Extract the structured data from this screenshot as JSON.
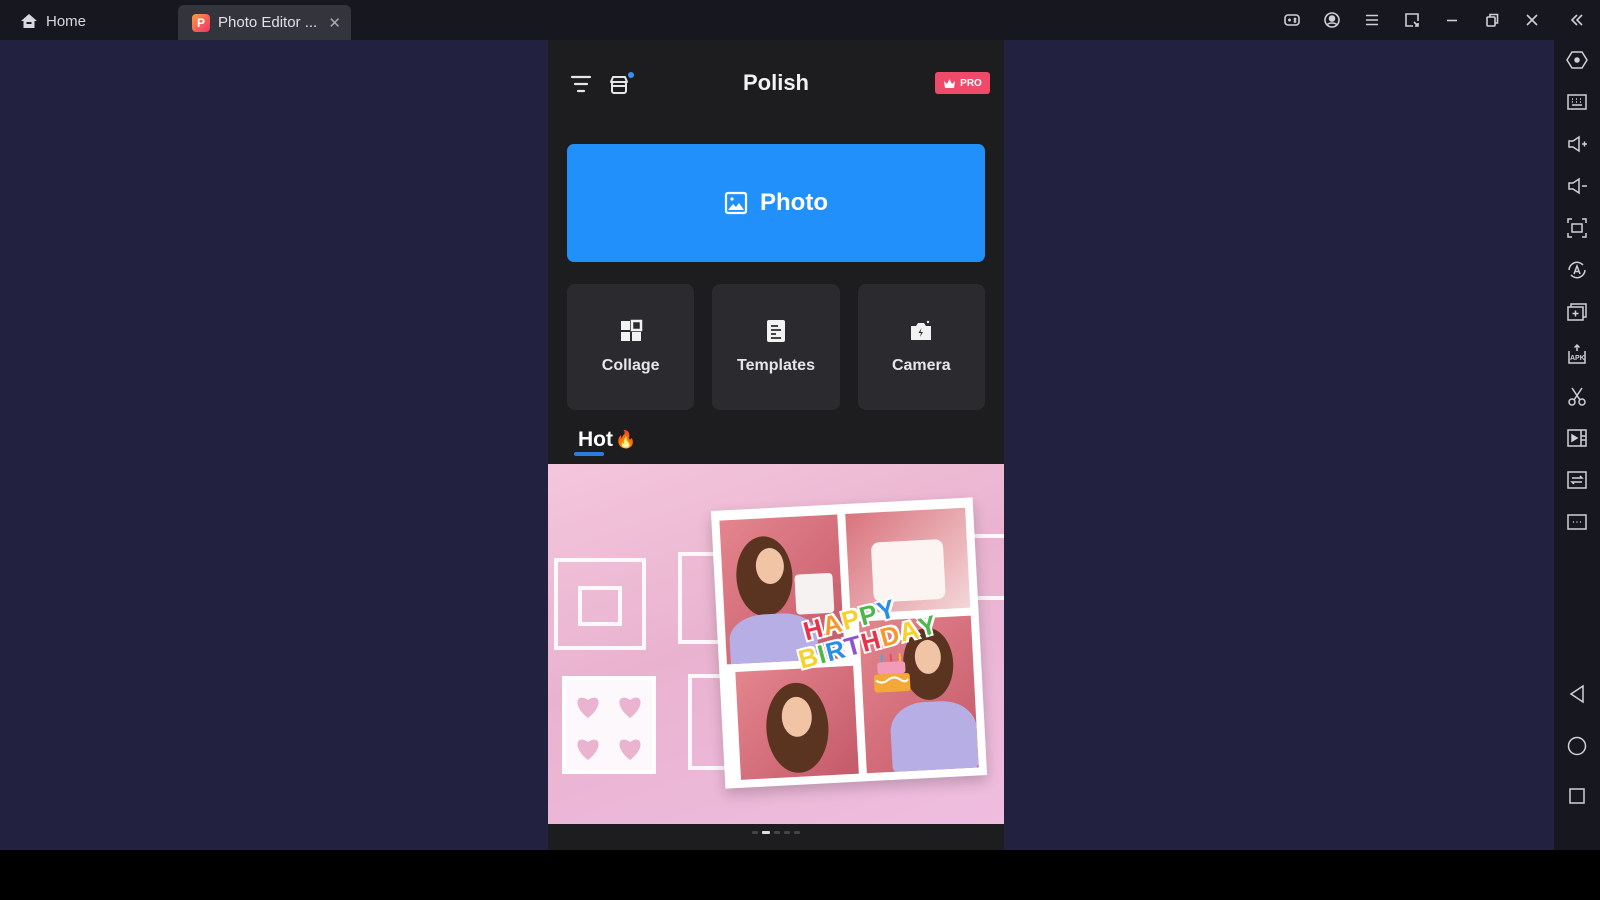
{
  "titlebar": {
    "home_tab": {
      "label": "Home",
      "icon": "home-icon"
    },
    "active_tab": {
      "label": "Photo Editor ...",
      "icon": "polish-app-icon",
      "close_icon": "close-icon"
    },
    "controls": [
      {
        "name": "gamepad-button",
        "icon": "gamepad-icon"
      },
      {
        "name": "account-button",
        "icon": "user-circle-icon"
      },
      {
        "name": "menu-button",
        "icon": "hamburger-icon"
      },
      {
        "name": "resize-button",
        "icon": "window-resize-icon"
      },
      {
        "name": "minimize-button",
        "icon": "minimize-icon"
      },
      {
        "name": "restore-button",
        "icon": "restore-icon"
      },
      {
        "name": "close-window-button",
        "icon": "close-icon"
      },
      {
        "name": "collapse-sidebar-button",
        "icon": "double-chevron-left-icon"
      }
    ]
  },
  "sidebar": {
    "items": [
      {
        "name": "settings",
        "icon": "hexagon-gear-icon"
      },
      {
        "name": "keyboard",
        "icon": "keyboard-icon"
      },
      {
        "name": "volume-up",
        "icon": "volume-up-icon"
      },
      {
        "name": "volume-down",
        "icon": "volume-down-icon"
      },
      {
        "name": "fullscreen",
        "icon": "fullscreen-icon"
      },
      {
        "name": "auto-rotate",
        "icon": "rotate-a-icon"
      },
      {
        "name": "multi-instance",
        "icon": "add-window-icon"
      },
      {
        "name": "install-apk",
        "icon": "apk-icon"
      },
      {
        "name": "screenshot",
        "icon": "scissors-icon"
      },
      {
        "name": "record",
        "icon": "video-record-icon"
      },
      {
        "name": "sync",
        "icon": "sync-icon"
      },
      {
        "name": "more",
        "icon": "more-icon"
      }
    ],
    "nav": [
      {
        "name": "back",
        "icon": "back-triangle-icon"
      },
      {
        "name": "home",
        "icon": "home-circle-icon"
      },
      {
        "name": "recents",
        "icon": "recents-square-icon"
      }
    ]
  },
  "app": {
    "title": "Polish",
    "pro_badge": "PRO",
    "photo_button": "Photo",
    "tiles": [
      {
        "label": "Collage",
        "icon": "collage-grid-icon"
      },
      {
        "label": "Templates",
        "icon": "templates-icon"
      },
      {
        "label": "Camera",
        "icon": "camera-icon"
      }
    ],
    "hot_section": {
      "label": "Hot",
      "emoji": "🔥"
    },
    "banner": {
      "line1": "HAPPY",
      "line2": "BIRTHDAY",
      "letter_colors": [
        "#e8324a",
        "#f29a2e",
        "#f5d12a",
        "#4cb84c",
        "#2b8ee6",
        "#8a55d0"
      ]
    },
    "pager": {
      "count": 5,
      "active": 1
    }
  }
}
